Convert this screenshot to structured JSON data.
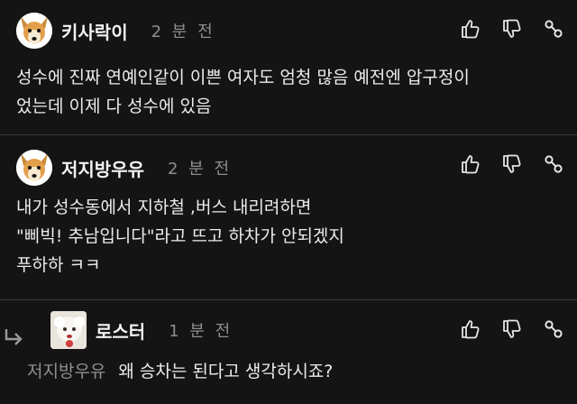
{
  "comments": [
    {
      "author": "키사락이",
      "time": "2 분 전",
      "lines": [
        "성수에 진짜 연예인같이 이쁜 여자도 엄청 많음 예전엔 압구정이",
        "었는데 이제 다 성수에 있음"
      ]
    },
    {
      "author": "저지방우유",
      "time": "2 분 전",
      "lines": [
        "내가 성수동에서 지하철 ,버스 내리려하면",
        "\"삐빅! 추남입니다\"라고 뜨고 하차가 안되겠지",
        "푸하하 ㅋㅋ"
      ]
    },
    {
      "author": "로스터",
      "time": "1 분 전",
      "mention": "저지방우유",
      "text": "왜 승차는 된다고 생각하시죠?"
    }
  ],
  "icons": {
    "like": "thumbs-up-icon",
    "dislike": "thumbs-down-icon",
    "link": "link-icon",
    "reply": "reply-arrow-icon"
  },
  "colors": {
    "background": "#141414",
    "text": "#ececec",
    "muted": "#8e8e8e",
    "divider": "#3a3a3a"
  }
}
